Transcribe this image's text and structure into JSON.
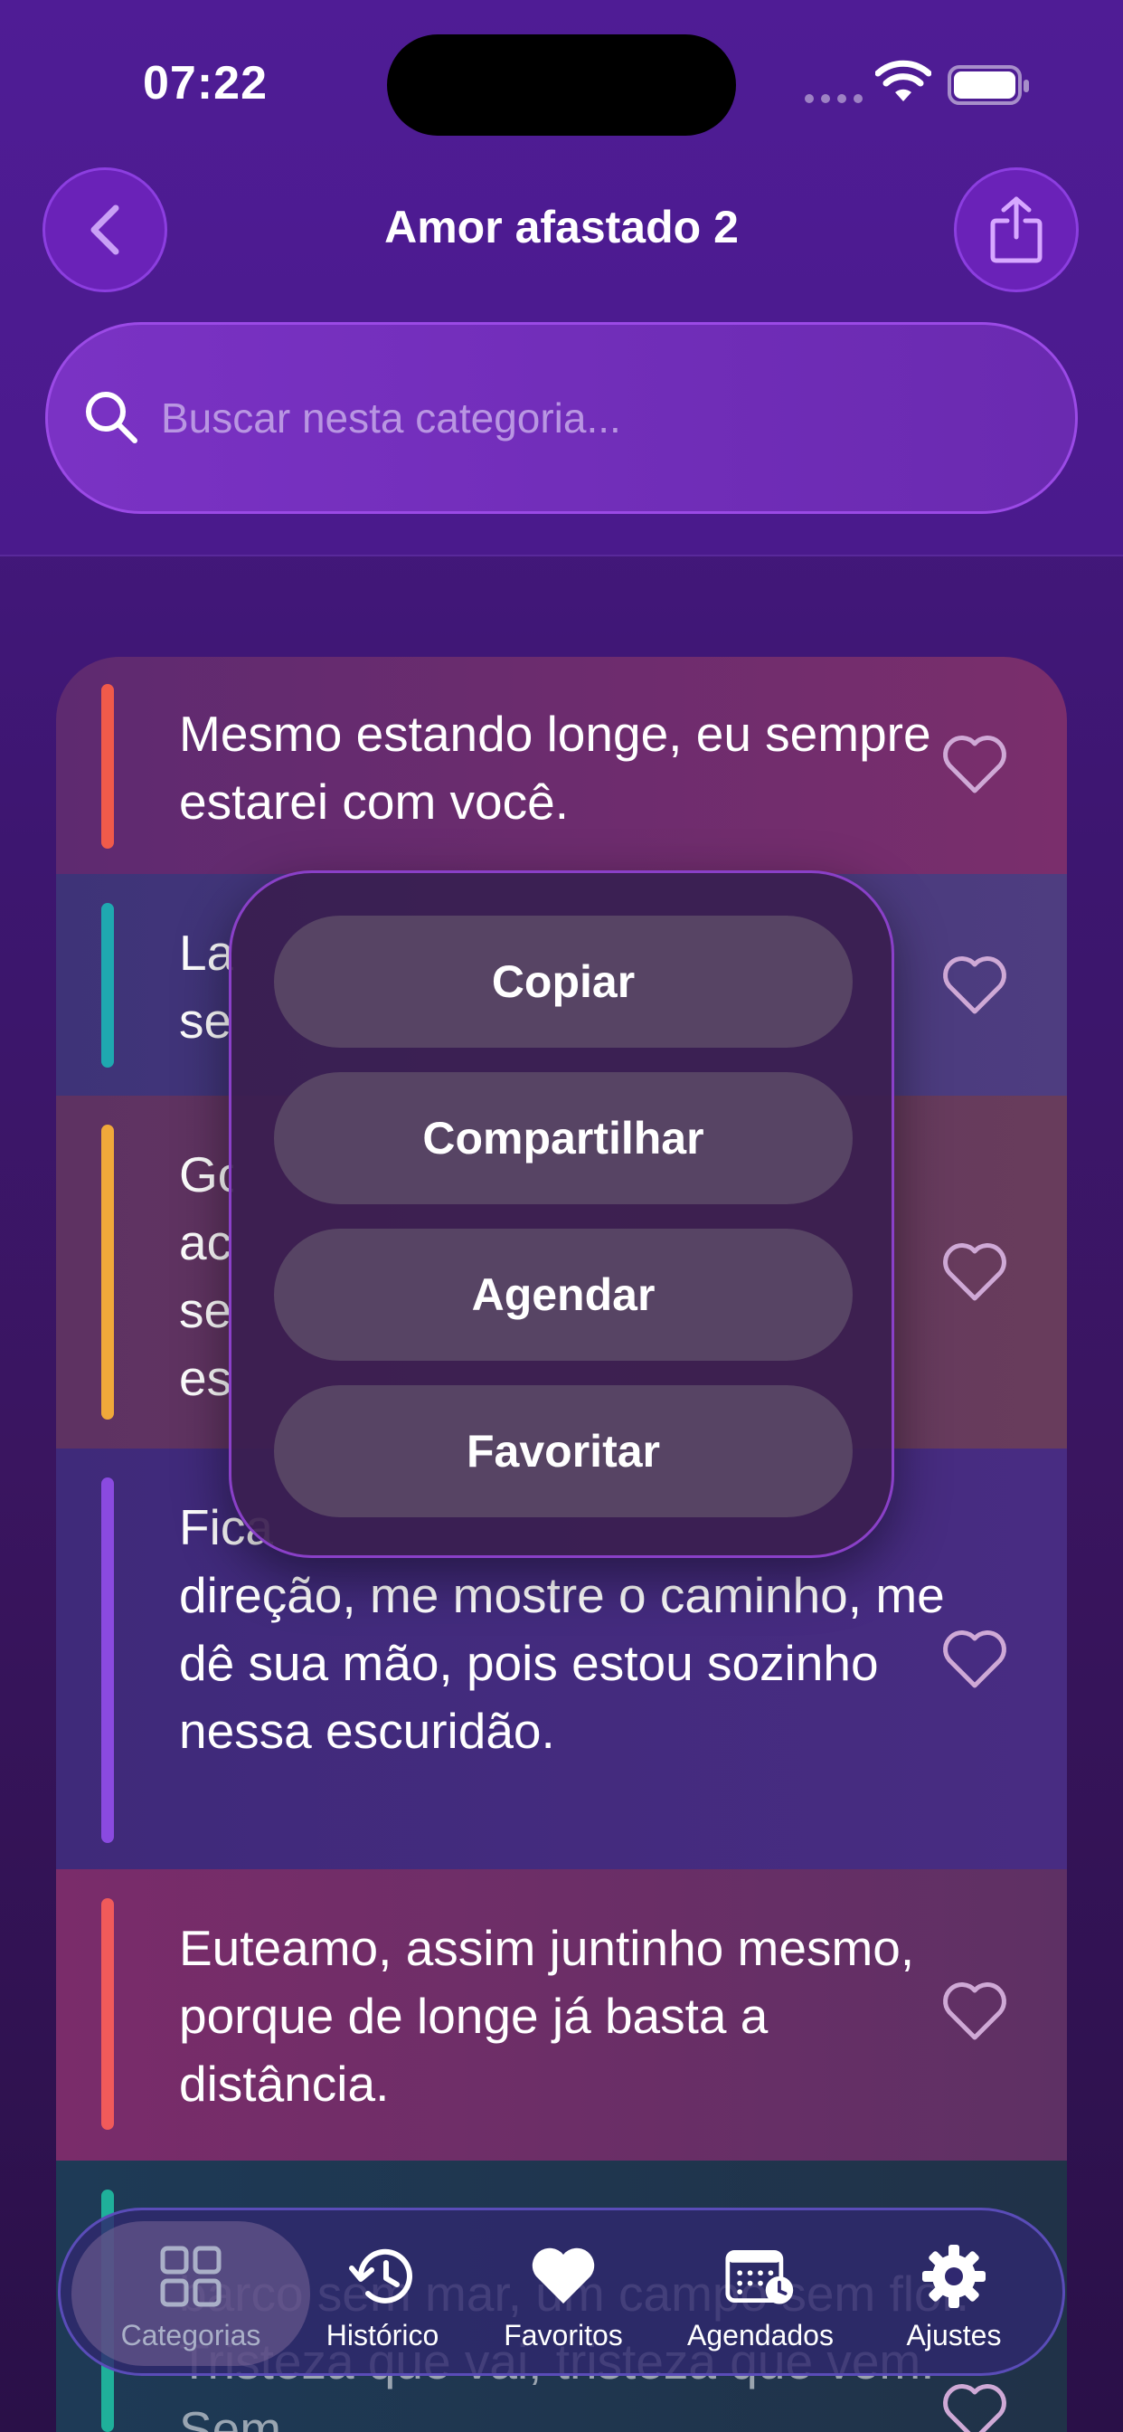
{
  "status_bar": {
    "time": "07:22"
  },
  "header": {
    "title": "Amor afastado 2"
  },
  "search": {
    "placeholder": "Buscar nesta categoria..."
  },
  "phrases": [
    {
      "text": "Mesmo estando longe, eu sempre estarei com você.",
      "accent": "#f05a4a",
      "bg": "#6e2a6e"
    },
    {
      "text": "La se",
      "accent": "#1fa8b0",
      "bg": "#4a3d80"
    },
    {
      "text": "Go ac se es",
      "accent": "#f0a83a",
      "bg": "#603a60"
    },
    {
      "text": "Fica direção, me mostre o caminho, me dê sua mão, pois estou sozinho nessa escuridão.",
      "accent": "#8a4ae0",
      "bg": "#432a80"
    },
    {
      "text": "Euteamo, assim juntinho mesmo, porque de longe já basta a distância.",
      "accent": "#f05a5a",
      "bg": "#6a2d68"
    },
    {
      "text": "barco sem mar, um campo sem flor. Tristeza que vai, tristeza que vem. Sem",
      "accent": "#1fb09a",
      "bg": "#1e3550"
    }
  ],
  "context_menu": {
    "copy": "Copiar",
    "share": "Compartilhar",
    "schedule": "Agendar",
    "favorite": "Favoritar"
  },
  "tabbar": {
    "categories": "Categorias",
    "history": "Histórico",
    "favorites": "Favoritos",
    "scheduled": "Agendados",
    "settings": "Ajustes"
  }
}
